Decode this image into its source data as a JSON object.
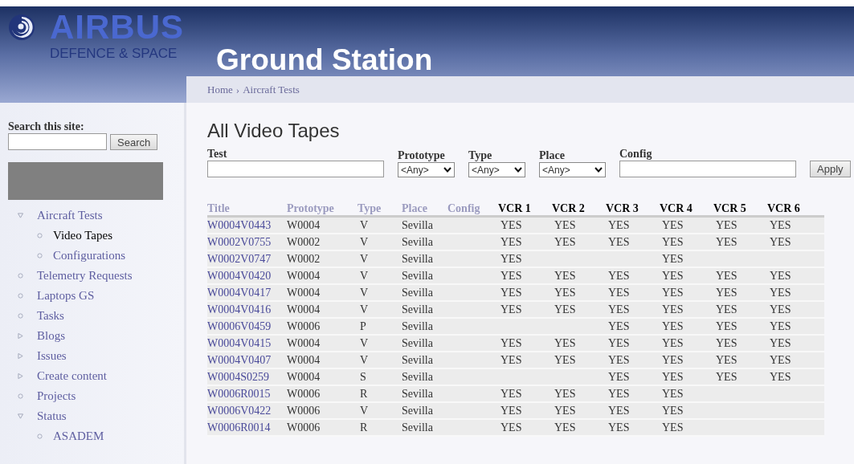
{
  "header": {
    "logo_name": "AIRBUS",
    "logo_tagline": "DEFENCE & SPACE",
    "title": "Ground Station"
  },
  "breadcrumb": {
    "items": [
      "Home",
      "Aircraft Tests"
    ],
    "separator": "›"
  },
  "search": {
    "label": "Search this site:",
    "button": "Search"
  },
  "sidebar": {
    "items": [
      {
        "label": "Aircraft Tests",
        "kind": "folder",
        "expanded": true,
        "selected": false,
        "children": [
          {
            "label": "Video Tapes",
            "kind": "leaf",
            "selected": true
          },
          {
            "label": "Configurations",
            "kind": "leaf",
            "selected": false
          }
        ]
      },
      {
        "label": "Telemetry Requests",
        "kind": "leaf",
        "selected": false
      },
      {
        "label": "Laptops GS",
        "kind": "leaf",
        "selected": false
      },
      {
        "label": "Tasks",
        "kind": "leaf",
        "selected": false
      },
      {
        "label": "Blogs",
        "kind": "folder",
        "expanded": false,
        "selected": false
      },
      {
        "label": "Issues",
        "kind": "folder",
        "expanded": false,
        "selected": false
      },
      {
        "label": "Create content",
        "kind": "folder",
        "expanded": false,
        "selected": false
      },
      {
        "label": "Projects",
        "kind": "leaf",
        "selected": false
      },
      {
        "label": "Status",
        "kind": "folder",
        "expanded": true,
        "selected": false,
        "children": [
          {
            "label": "ASADEM",
            "kind": "leaf",
            "selected": false
          }
        ]
      }
    ]
  },
  "page_title": "All Video Tapes",
  "filters": [
    {
      "label": "Test",
      "kind": "text"
    },
    {
      "label": "Prototype",
      "kind": "select",
      "value": "<Any>"
    },
    {
      "label": "Type",
      "kind": "select",
      "value": "<Any>"
    },
    {
      "label": "Place",
      "kind": "select",
      "value": "<Any>"
    },
    {
      "label": "Config",
      "kind": "text"
    }
  ],
  "apply_button": "Apply",
  "table": {
    "columns": [
      {
        "label": "Title",
        "kind": "sortable"
      },
      {
        "label": "Prototype",
        "kind": "sortable"
      },
      {
        "label": "Type",
        "kind": "sortable"
      },
      {
        "label": "Place",
        "kind": "sortable"
      },
      {
        "label": "Config",
        "kind": "sortable"
      },
      {
        "label": "VCR 1",
        "kind": "plain"
      },
      {
        "label": "VCR 2",
        "kind": "plain"
      },
      {
        "label": "VCR 3",
        "kind": "plain"
      },
      {
        "label": "VCR 4",
        "kind": "plain"
      },
      {
        "label": "VCR 5",
        "kind": "plain"
      },
      {
        "label": "VCR 6",
        "kind": "plain"
      }
    ],
    "rows": [
      {
        "title": "W0004V0443",
        "prototype": "W0004",
        "type": "V",
        "place": "Sevilla",
        "vcr_1": "YES",
        "vcr_2": "YES",
        "vcr_3": "YES",
        "vcr_4": "YES",
        "vcr_5": "YES",
        "vcr_6": "YES"
      },
      {
        "title": "W0002V0755",
        "prototype": "W0002",
        "type": "V",
        "place": "Sevilla",
        "vcr_1": "YES",
        "vcr_2": "YES",
        "vcr_3": "YES",
        "vcr_4": "YES",
        "vcr_5": "YES",
        "vcr_6": "YES"
      },
      {
        "title": "W0002V0747",
        "prototype": "W0002",
        "type": "V",
        "place": "Sevilla",
        "vcr_1": "YES",
        "vcr_4": "YES"
      },
      {
        "title": "W0004V0420",
        "prototype": "W0004",
        "type": "V",
        "place": "Sevilla",
        "vcr_1": "YES",
        "vcr_2": "YES",
        "vcr_3": "YES",
        "vcr_4": "YES",
        "vcr_5": "YES",
        "vcr_6": "YES"
      },
      {
        "title": "W0004V0417",
        "prototype": "W0004",
        "type": "V",
        "place": "Sevilla",
        "vcr_1": "YES",
        "vcr_2": "YES",
        "vcr_3": "YES",
        "vcr_4": "YES",
        "vcr_5": "YES",
        "vcr_6": "YES"
      },
      {
        "title": "W0004V0416",
        "prototype": "W0004",
        "type": "V",
        "place": "Sevilla",
        "vcr_1": "YES",
        "vcr_2": "YES",
        "vcr_3": "YES",
        "vcr_4": "YES",
        "vcr_5": "YES",
        "vcr_6": "YES"
      },
      {
        "title": "W0006V0459",
        "prototype": "W0006",
        "type": "P",
        "place": "Sevilla",
        "vcr_3": "YES",
        "vcr_4": "YES",
        "vcr_5": "YES",
        "vcr_6": "YES"
      },
      {
        "title": "W0004V0415",
        "prototype": "W0004",
        "type": "V",
        "place": "Sevilla",
        "vcr_1": "YES",
        "vcr_2": "YES",
        "vcr_3": "YES",
        "vcr_4": "YES",
        "vcr_5": "YES",
        "vcr_6": "YES"
      },
      {
        "title": "W0004V0407",
        "prototype": "W0004",
        "type": "V",
        "place": "Sevilla",
        "vcr_1": "YES",
        "vcr_2": "YES",
        "vcr_3": "YES",
        "vcr_4": "YES",
        "vcr_5": "YES",
        "vcr_6": "YES"
      },
      {
        "title": "W0004S0259",
        "prototype": "W0004",
        "type": "S",
        "place": "Sevilla",
        "vcr_3": "YES",
        "vcr_4": "YES",
        "vcr_5": "YES",
        "vcr_6": "YES"
      },
      {
        "title": "W0006R0015",
        "prototype": "W0006",
        "type": "R",
        "place": "Sevilla",
        "vcr_1": "YES",
        "vcr_2": "YES",
        "vcr_3": "YES",
        "vcr_4": "YES"
      },
      {
        "title": "W0006V0422",
        "prototype": "W0006",
        "type": "V",
        "place": "Sevilla",
        "vcr_1": "YES",
        "vcr_2": "YES",
        "vcr_3": "YES",
        "vcr_4": "YES"
      },
      {
        "title": "W0006R0014",
        "prototype": "W0006",
        "type": "R",
        "place": "Sevilla",
        "vcr_1": "YES",
        "vcr_2": "YES",
        "vcr_3": "YES",
        "vcr_4": "YES"
      }
    ]
  }
}
